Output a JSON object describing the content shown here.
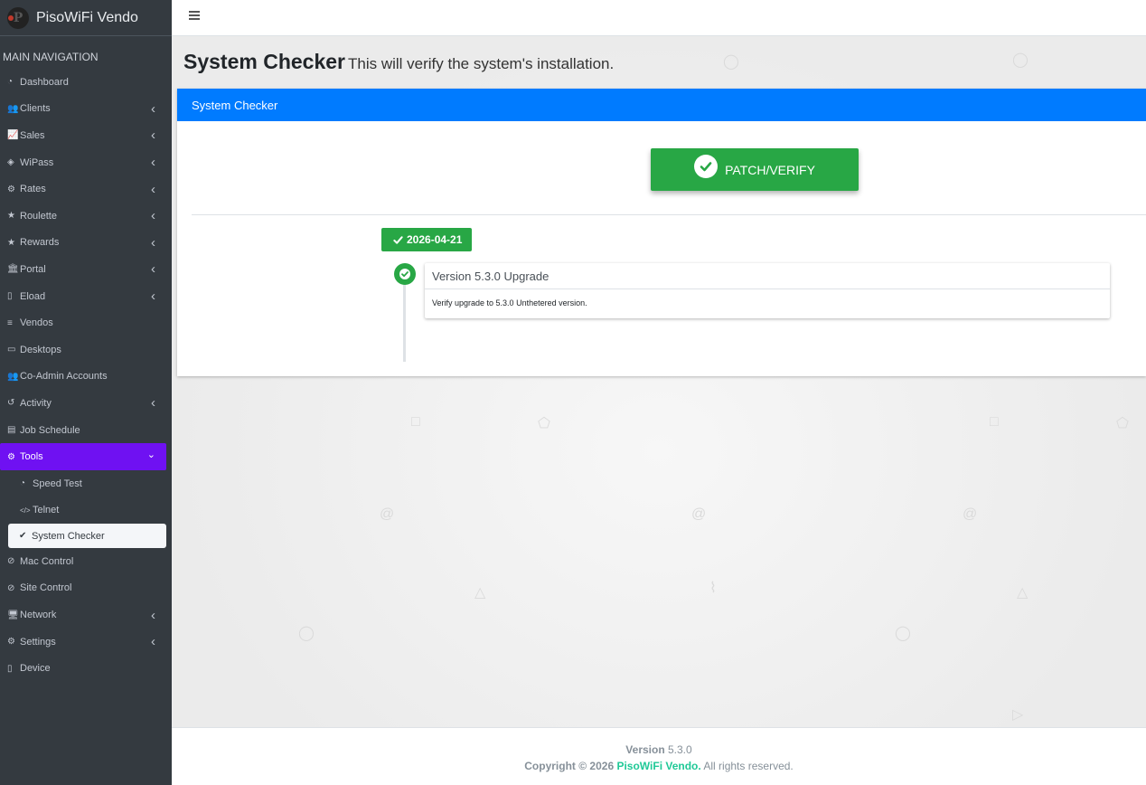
{
  "brand": {
    "name": "PisoWiFi Vendo",
    "logo_letter": "P"
  },
  "sidebar": {
    "header": "MAIN NAVIGATION",
    "items": [
      {
        "label": "Dashboard",
        "icon": "tachometer-icon",
        "glyph": "◔",
        "has_children": false
      },
      {
        "label": "Clients",
        "icon": "users-icon",
        "glyph": "👥",
        "has_children": true
      },
      {
        "label": "Sales",
        "icon": "chart-line-icon",
        "glyph": "📈",
        "has_children": true
      },
      {
        "label": "WiPass",
        "icon": "ticket-icon",
        "glyph": "◈",
        "has_children": true
      },
      {
        "label": "Rates",
        "icon": "cogs-icon",
        "glyph": "⚙",
        "has_children": true
      },
      {
        "label": "Roulette",
        "icon": "star-icon",
        "glyph": "★",
        "has_children": true
      },
      {
        "label": "Rewards",
        "icon": "star-icon",
        "glyph": "★",
        "has_children": true
      },
      {
        "label": "Portal",
        "icon": "university-icon",
        "glyph": "🏛",
        "has_children": true
      },
      {
        "label": "Eload",
        "icon": "mobile-icon",
        "glyph": "▯",
        "has_children": true
      },
      {
        "label": "Vendos",
        "icon": "database-icon",
        "glyph": "≡",
        "has_children": false
      },
      {
        "label": "Desktops",
        "icon": "laptop-icon",
        "glyph": "▭",
        "has_children": false
      },
      {
        "label": "Co-Admin Accounts",
        "icon": "users-icon",
        "glyph": "👥",
        "has_children": false
      },
      {
        "label": "Activity",
        "icon": "history-icon",
        "glyph": "↺",
        "has_children": true
      },
      {
        "label": "Job Schedule",
        "icon": "server-icon",
        "glyph": "▤",
        "has_children": false
      },
      {
        "label": "Tools",
        "icon": "cog-icon",
        "glyph": "⚙",
        "has_children": true,
        "active": true,
        "expanded": true
      }
    ],
    "tools_children": [
      {
        "label": "Speed Test",
        "icon": "tachometer-icon",
        "glyph": "◔"
      },
      {
        "label": "Telnet",
        "icon": "code-icon",
        "glyph": "</>"
      },
      {
        "label": "System Checker",
        "icon": "check-circle-icon",
        "glyph": "✔",
        "active": true
      }
    ],
    "items_after": [
      {
        "label": "Mac Control",
        "icon": "ban-icon",
        "glyph": "⊘",
        "has_children": false
      },
      {
        "label": "Site Control",
        "icon": "ban-icon",
        "glyph": "⊘",
        "has_children": false
      },
      {
        "label": "Network",
        "icon": "desktop-icon",
        "glyph": "🖥",
        "has_children": true
      },
      {
        "label": "Settings",
        "icon": "cogs-icon",
        "glyph": "⚙",
        "has_children": true
      },
      {
        "label": "Device",
        "icon": "mobile-icon",
        "glyph": "▯",
        "has_children": false
      }
    ]
  },
  "page": {
    "title": "System Checker",
    "subtitle": "This will verify the system's installation."
  },
  "card": {
    "header": "System Checker",
    "patch_button": "PATCH/VERIFY",
    "timeline": {
      "date": "2026-04-21",
      "items": [
        {
          "title": "Version 5.3.0 Upgrade",
          "body": "Verify upgrade to 5.3.0 Unthetered version."
        }
      ]
    }
  },
  "footer": {
    "version_label": "Version",
    "version": "5.3.0",
    "copyright_prefix": "Copyright © 2026",
    "brand": "PisoWiFi Vendo.",
    "rights": "All rights reserved."
  },
  "colors": {
    "sidebar_bg": "#343a40",
    "active_purple": "#6f11f2",
    "primary_blue": "#007bff",
    "success_green": "#28a745",
    "footer_brand": "#20c997"
  }
}
